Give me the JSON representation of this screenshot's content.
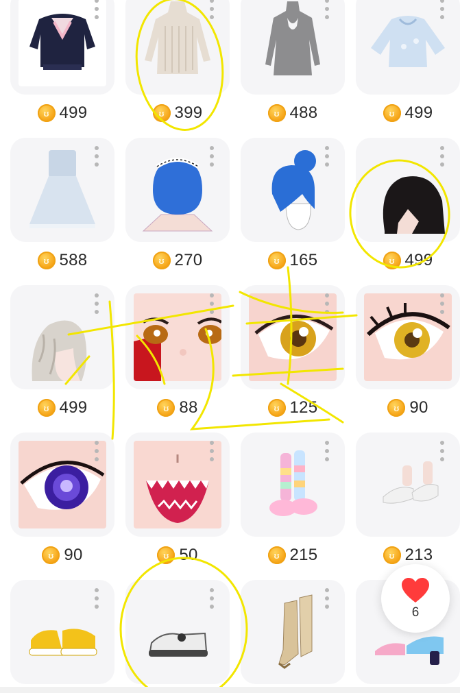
{
  "items": [
    {
      "name": "navy-sailor-top",
      "price": "499",
      "icon": "navy-sailor-top-icon"
    },
    {
      "name": "beige-knit-dress",
      "price": "399",
      "icon": "beige-knit-dress-icon"
    },
    {
      "name": "grey-halter-dress",
      "price": "488",
      "icon": "grey-halter-dress-icon"
    },
    {
      "name": "light-blue-sweater",
      "price": "499",
      "icon": "light-blue-sweater-icon"
    },
    {
      "name": "white-strapless-dress",
      "price": "588",
      "icon": "white-strapless-dress-icon"
    },
    {
      "name": "blue-bob-maid-hair",
      "price": "270",
      "icon": "blue-bob-hair-icon"
    },
    {
      "name": "blue-bun-hair",
      "price": "165",
      "icon": "blue-bun-hair-icon"
    },
    {
      "name": "black-long-hair",
      "price": "499",
      "icon": "black-long-hair-icon"
    },
    {
      "name": "silver-wavy-hair",
      "price": "499",
      "icon": "silver-wavy-hair-icon"
    },
    {
      "name": "anime-face-eyes",
      "price": "88",
      "icon": "anime-face-icon"
    },
    {
      "name": "golden-eye-pink",
      "price": "125",
      "icon": "golden-eye-icon"
    },
    {
      "name": "golden-eye-lashes",
      "price": "90",
      "icon": "golden-eye-lashes-icon"
    },
    {
      "name": "purple-skull-eye",
      "price": "90",
      "icon": "purple-skull-eye-icon"
    },
    {
      "name": "shark-mouth",
      "price": "50",
      "icon": "shark-mouth-icon"
    },
    {
      "name": "rainbow-socks-shoes",
      "price": "215",
      "icon": "rainbow-socks-icon"
    },
    {
      "name": "white-heels",
      "price": "213",
      "icon": "white-heels-icon"
    },
    {
      "name": "yellow-sneakers",
      "price": "",
      "icon": "yellow-sneakers-icon"
    },
    {
      "name": "white-platform-shoes",
      "price": "",
      "icon": "white-platform-shoes-icon"
    },
    {
      "name": "tan-boots",
      "price": "",
      "icon": "tan-boots-icon"
    },
    {
      "name": "pink-blue-heels",
      "price": "",
      "icon": "pink-blue-heels-icon"
    }
  ],
  "favorites": {
    "count": "6",
    "icon": "heart-icon"
  },
  "coin_symbol": "ʊ",
  "colors": {
    "card": "#f5f5f7",
    "coin": "#f7a81c",
    "annotation": "#f2e600",
    "heart": "#ff3b3b"
  }
}
